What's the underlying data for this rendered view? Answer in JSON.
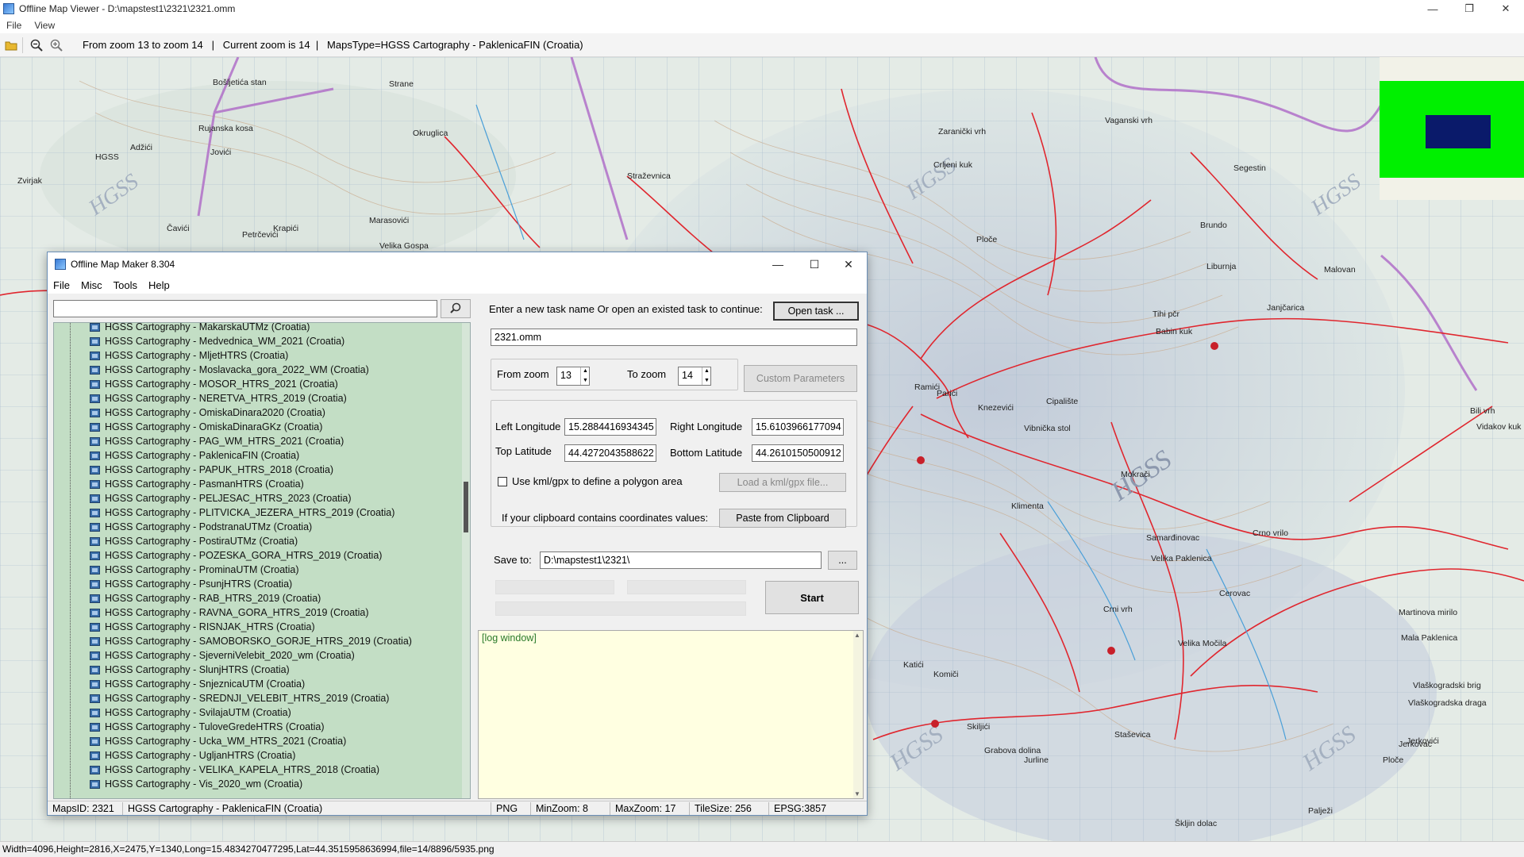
{
  "outer_window": {
    "title": "Offline Map Viewer - D:\\mapstest1\\2321\\2321.omm",
    "menu": [
      "File",
      "View"
    ],
    "toolbar": {
      "icons": [
        "open-folder-icon",
        "zoom-out-icon",
        "zoom-in-icon"
      ],
      "status_text": "From zoom 13 to zoom 14   |   Current zoom is 14  |   MapsType=HGSS Cartography - PaklenicaFIN (Croatia)"
    },
    "status_bar": "Width=4096,Height=2816,X=2475,Y=1340,Long=15.4834270477295,Lat=44.3515958636994,file=14/8896/5935.png",
    "colors": {
      "minimap_frame": "#00f000",
      "minimap_view": "#0a1a6a",
      "map_route": "#e0262e",
      "map_border": "#b070c8"
    }
  },
  "map_labels": [
    {
      "text": "Bošljetića stan"
    },
    {
      "text": "Rujanska kosa"
    },
    {
      "text": "Strane"
    },
    {
      "text": "HGSS"
    },
    {
      "text": "Adžići"
    },
    {
      "text": "Jovići"
    },
    {
      "text": "Zvirjak"
    },
    {
      "text": "Čavići"
    },
    {
      "text": "Petrčevići"
    },
    {
      "text": "Krapići"
    },
    {
      "text": "Marasovići"
    },
    {
      "text": "Velika Gospa"
    },
    {
      "text": "Straževnica"
    },
    {
      "text": "Okruglica"
    },
    {
      "text": "Zaranički vrh"
    },
    {
      "text": "Crljeni kuk"
    },
    {
      "text": "Vaganski vrh"
    },
    {
      "text": "Segestin"
    },
    {
      "text": "Ploče"
    },
    {
      "text": "Brundo"
    },
    {
      "text": "Liburnja"
    },
    {
      "text": "Malovan"
    },
    {
      "text": "Janjčarica"
    },
    {
      "text": "Tihi pčr"
    },
    {
      "text": "Babin kuk"
    },
    {
      "text": "Ramići"
    },
    {
      "text": "Parići"
    },
    {
      "text": "Knezevići"
    },
    {
      "text": "Cipalište"
    },
    {
      "text": "Vibnička stol"
    },
    {
      "text": "Mokrači"
    },
    {
      "text": "Klimenta"
    },
    {
      "text": "Samarđinovac"
    },
    {
      "text": "Crno vrilo"
    },
    {
      "text": "Velika Paklenica"
    },
    {
      "text": "Cerovac"
    },
    {
      "text": "Crni vrh"
    },
    {
      "text": "Velika Močila"
    },
    {
      "text": "Martinova mirilo"
    },
    {
      "text": "Mala Paklenica"
    },
    {
      "text": "Vlaškogradski brig"
    },
    {
      "text": "Vlaškogradska draga"
    },
    {
      "text": "Jurline"
    },
    {
      "text": "Skiljići"
    },
    {
      "text": "Grabova dolina"
    },
    {
      "text": "Staševica"
    },
    {
      "text": "Ploče"
    },
    {
      "text": "Palježi"
    },
    {
      "text": "Škljin dolac"
    },
    {
      "text": "Komiči"
    },
    {
      "text": "Katići"
    },
    {
      "text": "Jerkovac"
    },
    {
      "text": "Jerkovići"
    },
    {
      "text": "Bili vrh"
    },
    {
      "text": "Vidakov kuk"
    }
  ],
  "dialog": {
    "title": "Offline Map Maker 8.304",
    "menu": [
      "File",
      "Misc",
      "Tools",
      "Help"
    ],
    "search": {
      "value": "",
      "placeholder": ""
    },
    "tree_items": [
      "HGSS Cartography - MakarskaUTMz (Croatia)",
      "HGSS Cartography - Medvednica_WM_2021 (Croatia)",
      "HGSS Cartography - MljetHTRS (Croatia)",
      "HGSS Cartography - Moslavacka_gora_2022_WM (Croatia)",
      "HGSS Cartography - MOSOR_HTRS_2021 (Croatia)",
      "HGSS Cartography - NERETVA_HTRS_2019 (Croatia)",
      "HGSS Cartography - OmiskaDinara2020 (Croatia)",
      "HGSS Cartography - OmiskaDinaraGKz (Croatia)",
      "HGSS Cartography - PAG_WM_HTRS_2021 (Croatia)",
      "HGSS Cartography - PaklenicaFIN (Croatia)",
      "HGSS Cartography - PAPUK_HTRS_2018 (Croatia)",
      "HGSS Cartography - PasmanHTRS (Croatia)",
      "HGSS Cartography - PELJESAC_HTRS_2023 (Croatia)",
      "HGSS Cartography - PLITVICKA_JEZERA_HTRS_2019 (Croatia)",
      "HGSS Cartography - PodstranaUTMz (Croatia)",
      "HGSS Cartography - PostiraUTMz (Croatia)",
      "HGSS Cartography - POZESKA_GORA_HTRS_2019 (Croatia)",
      "HGSS Cartography - ProminaUTM (Croatia)",
      "HGSS Cartography - PsunjHTRS (Croatia)",
      "HGSS Cartography - RAB_HTRS_2019 (Croatia)",
      "HGSS Cartography - RAVNA_GORA_HTRS_2019 (Croatia)",
      "HGSS Cartography - RISNJAK_HTRS (Croatia)",
      "HGSS Cartography - SAMOBORSKO_GORJE_HTRS_2019 (Croatia)",
      "HGSS Cartography - SjeverniVelebit_2020_wm (Croatia)",
      "HGSS Cartography - SlunjHTRS (Croatia)",
      "HGSS Cartography - SnjeznicaUTM (Croatia)",
      "HGSS Cartography - SREDNJI_VELEBIT_HTRS_2019 (Croatia)",
      "HGSS Cartography - SvilajaUTM (Croatia)",
      "HGSS Cartography - TuloveGredeHTRS (Croatia)",
      "HGSS Cartography - Ucka_WM_HTRS_2021 (Croatia)",
      "HGSS Cartography - UgljanHTRS (Croatia)",
      "HGSS Cartography - VELIKA_KAPELA_HTRS_2018 (Croatia)",
      "HGSS Cartography - Vis_2020_wm (Croatia)"
    ],
    "task_prompt": "Enter a new task name Or open an existed task to continue:",
    "open_task_label": "Open task ...",
    "task_name": "2321.omm",
    "from_zoom_label": "From zoom",
    "from_zoom_value": "13",
    "to_zoom_label": "To zoom",
    "to_zoom_value": "14",
    "custom_params_label": "Custom Parameters",
    "left_lon_label": "Left Longitude",
    "left_lon_value": "15.2884416934345",
    "right_lon_label": "Right Longitude",
    "right_lon_value": "15.6103966177094",
    "top_lat_label": "Top Latitude",
    "top_lat_value": "44.4272043588622",
    "bottom_lat_label": "Bottom Latitude",
    "bottom_lat_value": "44.2610150500912",
    "kml_checkbox_label": "Use kml/gpx to define a polygon area",
    "load_kml_label": "Load a kml/gpx file...",
    "clipboard_prompt": "If your clipboard contains coordinates values:",
    "paste_label": "Paste from Clipboard",
    "save_to_label": "Save to:",
    "save_to_value": "D:\\mapstest1\\2321\\",
    "browse_label": "...",
    "start_label": "Start",
    "log_text": "[log window]",
    "status": {
      "maps_id": "MapsID: 2321",
      "maps_name": "HGSS Cartography - PaklenicaFIN (Croatia)",
      "format": "PNG",
      "min_zoom": "MinZoom: 8",
      "max_zoom": "MaxZoom: 17",
      "tile_size": "TileSize: 256",
      "epsg": "EPSG:3857"
    }
  }
}
